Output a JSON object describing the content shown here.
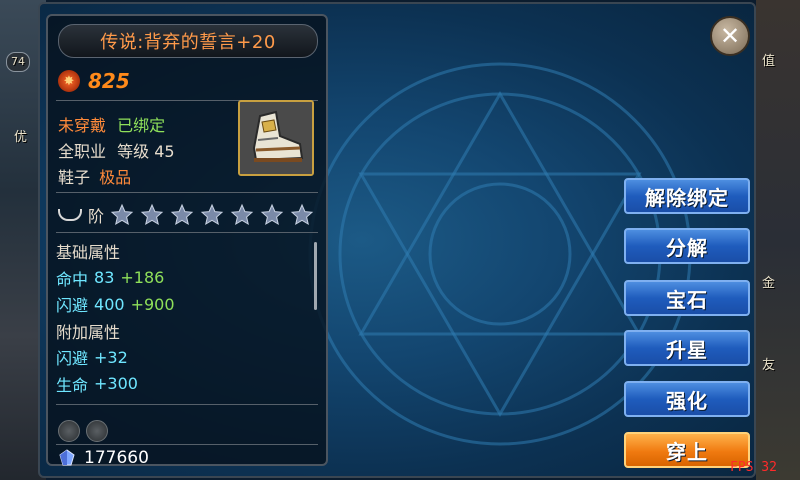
{
  "item": {
    "title": "传说:背弃的誓言+20",
    "power": "825",
    "equip_status": "未穿戴",
    "bind_status": "已绑定",
    "class_text": "全职业",
    "level_label": "等级",
    "level_value": "45",
    "slot_label": "鞋子",
    "quality": "极品",
    "tier_label": "阶",
    "star_count": 7,
    "attr_section_base": "基础属性",
    "attrs_base": [
      {
        "name": "命中",
        "value": "83",
        "bonus": "+186"
      },
      {
        "name": "闪避",
        "value": "400",
        "bonus": "+900"
      }
    ],
    "attr_section_extra": "附加属性",
    "attrs_extra": [
      {
        "name": "闪避",
        "value": "+32"
      },
      {
        "name": "生命",
        "value": "+300"
      }
    ],
    "gem_slots": 2,
    "money": "177660"
  },
  "buttons": {
    "unbind": "解除绑定",
    "decompose": "分解",
    "gem": "宝石",
    "star_up": "升星",
    "enhance": "强化",
    "equip": "穿上"
  },
  "side": {
    "left_level": "74",
    "left_text": "优",
    "right_text_1": "值",
    "right_text_2": "金",
    "right_text_3": "友"
  },
  "fps_text": "FPS 32",
  "icons": {
    "close": "close-icon",
    "power": "power-icon",
    "tier": "tier-icon",
    "star": "star-icon",
    "gem_slot": "gem-slot-icon",
    "currency": "crystal-icon"
  },
  "colors": {
    "title": "#ff9a4a",
    "power": "#ff8a1a",
    "quality": "#ff8a3a",
    "bound": "#8fe05a",
    "attr": "#6fe6ff",
    "button_blue": "#1f5cbd",
    "button_orange": "#f07a10"
  }
}
